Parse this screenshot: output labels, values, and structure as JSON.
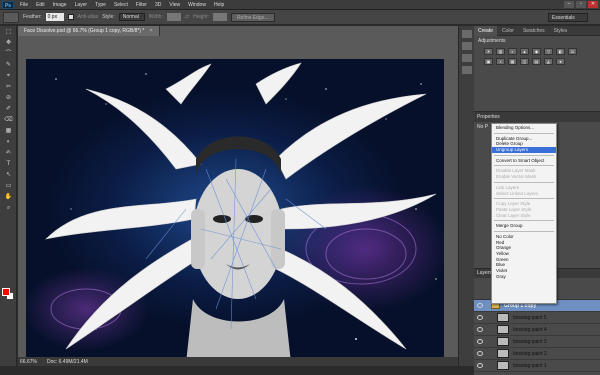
{
  "app": {
    "logo": "Ps",
    "menus": [
      "File",
      "Edit",
      "Image",
      "Layer",
      "Type",
      "Select",
      "Filter",
      "3D",
      "View",
      "Window",
      "Help"
    ]
  },
  "options_bar": {
    "feather_label": "Feather:",
    "feather_value": "0 px",
    "antialias_label": "Anti-alias",
    "style_label": "Style:",
    "style_value": "Normal",
    "width_label": "Width:",
    "height_label": "Height:",
    "refine_edge_label": "Refine Edge...",
    "workspace_value": "Essentials"
  },
  "document": {
    "tab_title": "Face Dissolve.psd @ 66.7% (Group 1 copy, RGB/8*) *",
    "tab_close": "×",
    "status_zoom": "66.67%",
    "status_doc": "Doc: 6.49M/21.4M"
  },
  "panels": {
    "top_tabs": [
      "Create",
      "Color",
      "Swatches",
      "Styles"
    ],
    "adjustments_header": "Adjustments",
    "adjustment_icons": [
      "☀",
      "▥",
      "◐",
      "▲",
      "◆",
      "▽",
      "◧",
      "⚖",
      "▣",
      "◑",
      "▦",
      "◫",
      "▤",
      "◭",
      "●"
    ],
    "properties_title": "Properties",
    "properties_nosel": "No P",
    "layers_title": "Layers"
  },
  "layers": [
    {
      "name": "Group 1 copy",
      "type": "group",
      "selected": true
    },
    {
      "name": "bossing paint 5",
      "type": "layer"
    },
    {
      "name": "bossing paint 4",
      "type": "layer"
    },
    {
      "name": "bossing paint 3",
      "type": "layer"
    },
    {
      "name": "bossing paint 2",
      "type": "layer"
    },
    {
      "name": "bossing paint 1",
      "type": "layer"
    }
  ],
  "context_menu": [
    {
      "label": "Blending Options...",
      "state": "normal"
    },
    {
      "sep": true
    },
    {
      "label": "Duplicate Group...",
      "state": "normal"
    },
    {
      "label": "Delete Group",
      "state": "normal"
    },
    {
      "label": "Ungroup Layers",
      "state": "highlight"
    },
    {
      "sep": true
    },
    {
      "label": "Convert to Smart Object",
      "state": "normal"
    },
    {
      "sep": true
    },
    {
      "label": "Disable Layer Mask",
      "state": "disabled"
    },
    {
      "label": "Enable Vector Mask",
      "state": "disabled"
    },
    {
      "sep": true
    },
    {
      "label": "Link Layers",
      "state": "disabled"
    },
    {
      "label": "Select Linked Layers",
      "state": "disabled"
    },
    {
      "sep": true
    },
    {
      "label": "Copy Layer Style",
      "state": "disabled"
    },
    {
      "label": "Paste Layer Style",
      "state": "disabled"
    },
    {
      "label": "Clear Layer Style",
      "state": "disabled"
    },
    {
      "sep": true
    },
    {
      "label": "Merge Group",
      "state": "normal"
    },
    {
      "sep": true
    },
    {
      "label": "No Color",
      "state": "normal"
    },
    {
      "label": "Red",
      "state": "normal"
    },
    {
      "label": "Orange",
      "state": "normal"
    },
    {
      "label": "Yellow",
      "state": "normal"
    },
    {
      "label": "Green",
      "state": "normal"
    },
    {
      "label": "Blue",
      "state": "normal"
    },
    {
      "label": "Violet",
      "state": "normal"
    },
    {
      "label": "Gray",
      "state": "normal"
    }
  ],
  "colors": {
    "foreground": "#ff0000",
    "background": "#ffffff",
    "selection_highlight": "#3a6fd8",
    "layer_selected": "#6d8fc2"
  },
  "tools": [
    "⬚",
    "✥",
    "⌒",
    "✎",
    "⌖",
    "✂",
    "⊘",
    "✐",
    "⌫",
    "▦",
    "◐",
    "✍",
    "T",
    "↖",
    "▭",
    "✋",
    "⌕"
  ]
}
